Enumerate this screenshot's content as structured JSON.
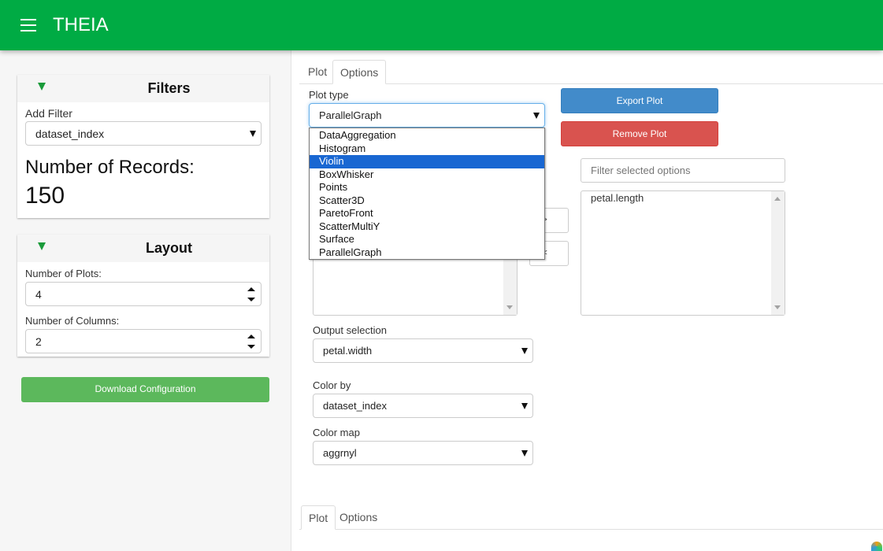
{
  "header": {
    "title": "THEIA",
    "menu_icon": "hamburger-icon",
    "color": "#00ab44"
  },
  "sidebar": {
    "filters": {
      "title": "Filters",
      "add_filter_label": "Add Filter",
      "add_filter_value": "dataset_index",
      "records_label": "Number of Records:",
      "records_value": "150"
    },
    "layout": {
      "title": "Layout",
      "plots_label": "Number of Plots:",
      "plots_value": "4",
      "columns_label": "Number of Columns:",
      "columns_value": "2"
    },
    "download_label": "Download Configuration"
  },
  "main": {
    "tabs": [
      {
        "label": "Plot"
      },
      {
        "label": "Options"
      }
    ],
    "plot_type_label": "Plot type",
    "plot_type_value": "ParallelGraph",
    "plot_type_options": [
      "DataAggregation",
      "Histogram",
      "Violin",
      "BoxWhisker",
      "Points",
      "Scatter3D",
      "ParetoFront",
      "ScatterMultiY",
      "Surface",
      "ParallelGraph"
    ],
    "highlighted_option": "Violin",
    "export_label": "Export Plot",
    "remove_label": "Remove Plot",
    "filter_selected_placeholder": "Filter selected options",
    "selected_options": [
      "petal.length"
    ],
    "add_label": ">>",
    "remove_sel_label": "<<",
    "output_selection_label": "Output selection",
    "output_selection_value": "petal.width",
    "color_by_label": "Color by",
    "color_by_value": "dataset_index",
    "color_map_label": "Color map",
    "color_map_value": "aggrnyl",
    "bottom_tabs": [
      {
        "label": "Plot"
      },
      {
        "label": "Options"
      }
    ]
  }
}
